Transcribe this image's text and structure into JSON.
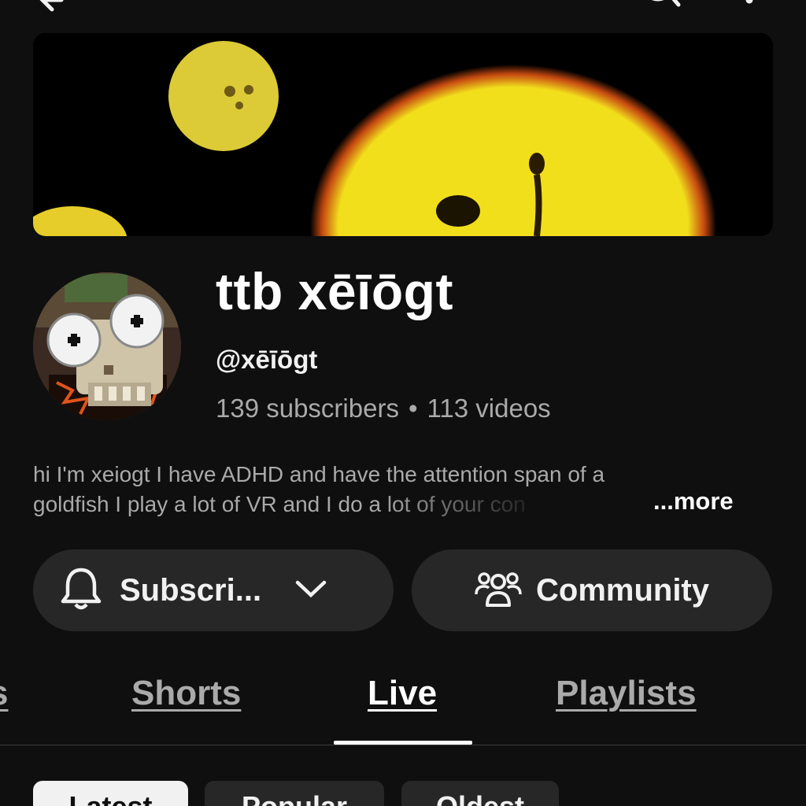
{
  "header": {
    "back_icon": "arrow-left-icon",
    "search_icon": "search-icon",
    "more_icon": "more-vertical-icon"
  },
  "channel": {
    "name": "ttb xēīōgt",
    "handle": "@xēīōgt",
    "subscribers": "139 subscribers",
    "separator": "•",
    "videos": "113 videos",
    "description_line1": "hi I'm xeiogt I have ADHD and have the attention span of a",
    "description_line2": "goldfish I play a lot of VR and I do a lot of your con",
    "more_label": "...more"
  },
  "actions": {
    "subscribe_label": "Subscri...",
    "community_label": "Community"
  },
  "tabs": {
    "partial": "s",
    "shorts": "Shorts",
    "live": "Live",
    "playlists": "Playlists",
    "active": "Live"
  },
  "chips": {
    "latest": "Latest",
    "popular": "Popular",
    "oldest": "Oldest",
    "selected": "Latest"
  },
  "colors": {
    "background": "#0f0f0f",
    "surface": "#272727",
    "banner_yellow": "#f2e01e"
  }
}
